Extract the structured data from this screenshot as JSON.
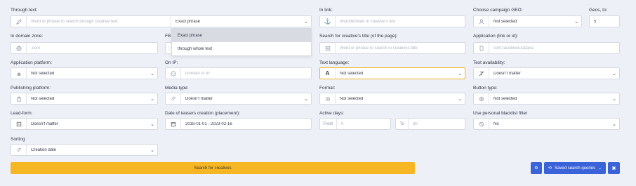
{
  "through_text": {
    "label": "Through text:",
    "placeholder": "Word or phrase to search through creative text",
    "mode": "Exact phrase",
    "options": [
      "Exact phrase",
      "through whole text"
    ]
  },
  "in_link": {
    "label": "In link:",
    "placeholder": "Word/domain in creative's link"
  },
  "campaign_geo": {
    "label": "Choose campaign GEO:",
    "value": "Not selected"
  },
  "geos_to": {
    "label": "Geos, to:",
    "value": "5"
  },
  "in_domain_zone": {
    "label": "In domain zone:",
    "placeholder": ".com"
  },
  "fb_label": "FB p",
  "creative_title": {
    "label": "Search for creative's title (of the page):",
    "placeholder": "Word or phrase to search in creatives title"
  },
  "application": {
    "label": "Application (link or id):",
    "placeholder": "com.facebook.katana"
  },
  "app_platform": {
    "label": "Application platform:",
    "value": "Not selected"
  },
  "on_ip": {
    "label": "On IP:",
    "placeholder": "Domain or IP"
  },
  "text_language": {
    "label": "Text language:",
    "value": "Not selected",
    "icon_letter": "A"
  },
  "text_availability": {
    "label": "Text availability:",
    "value": "Doesn't matter"
  },
  "publishing_platform": {
    "label": "Publishing platform:",
    "value": "Not selected"
  },
  "media_type": {
    "label": "Media type:",
    "value": "Doesn't matter"
  },
  "format": {
    "label": "Format:",
    "value": "Not selected"
  },
  "button_type": {
    "label": "Button type:",
    "value": "Not selected"
  },
  "lead_form": {
    "label": "Lead-form:",
    "value": "Doesn't matter"
  },
  "teasers_date": {
    "label": "Date of teasers creation (placement):",
    "value": "2018-01-01 - 2023-02-16"
  },
  "active_days": {
    "label": "Active days:",
    "from_label": "From",
    "from_value": "0",
    "to_label": "To",
    "to_value": "30"
  },
  "blacklist": {
    "label": "Use personal blacklist filter",
    "value": "No"
  },
  "sorting": {
    "label": "Sorting",
    "value": "Creation date"
  },
  "actions": {
    "search_label": "Search for creatives",
    "saved_queries_label": "Saved search queries"
  },
  "colors": {
    "accent": "#f7b724",
    "blue": "#3b63d9",
    "background": "#eef0f7"
  }
}
